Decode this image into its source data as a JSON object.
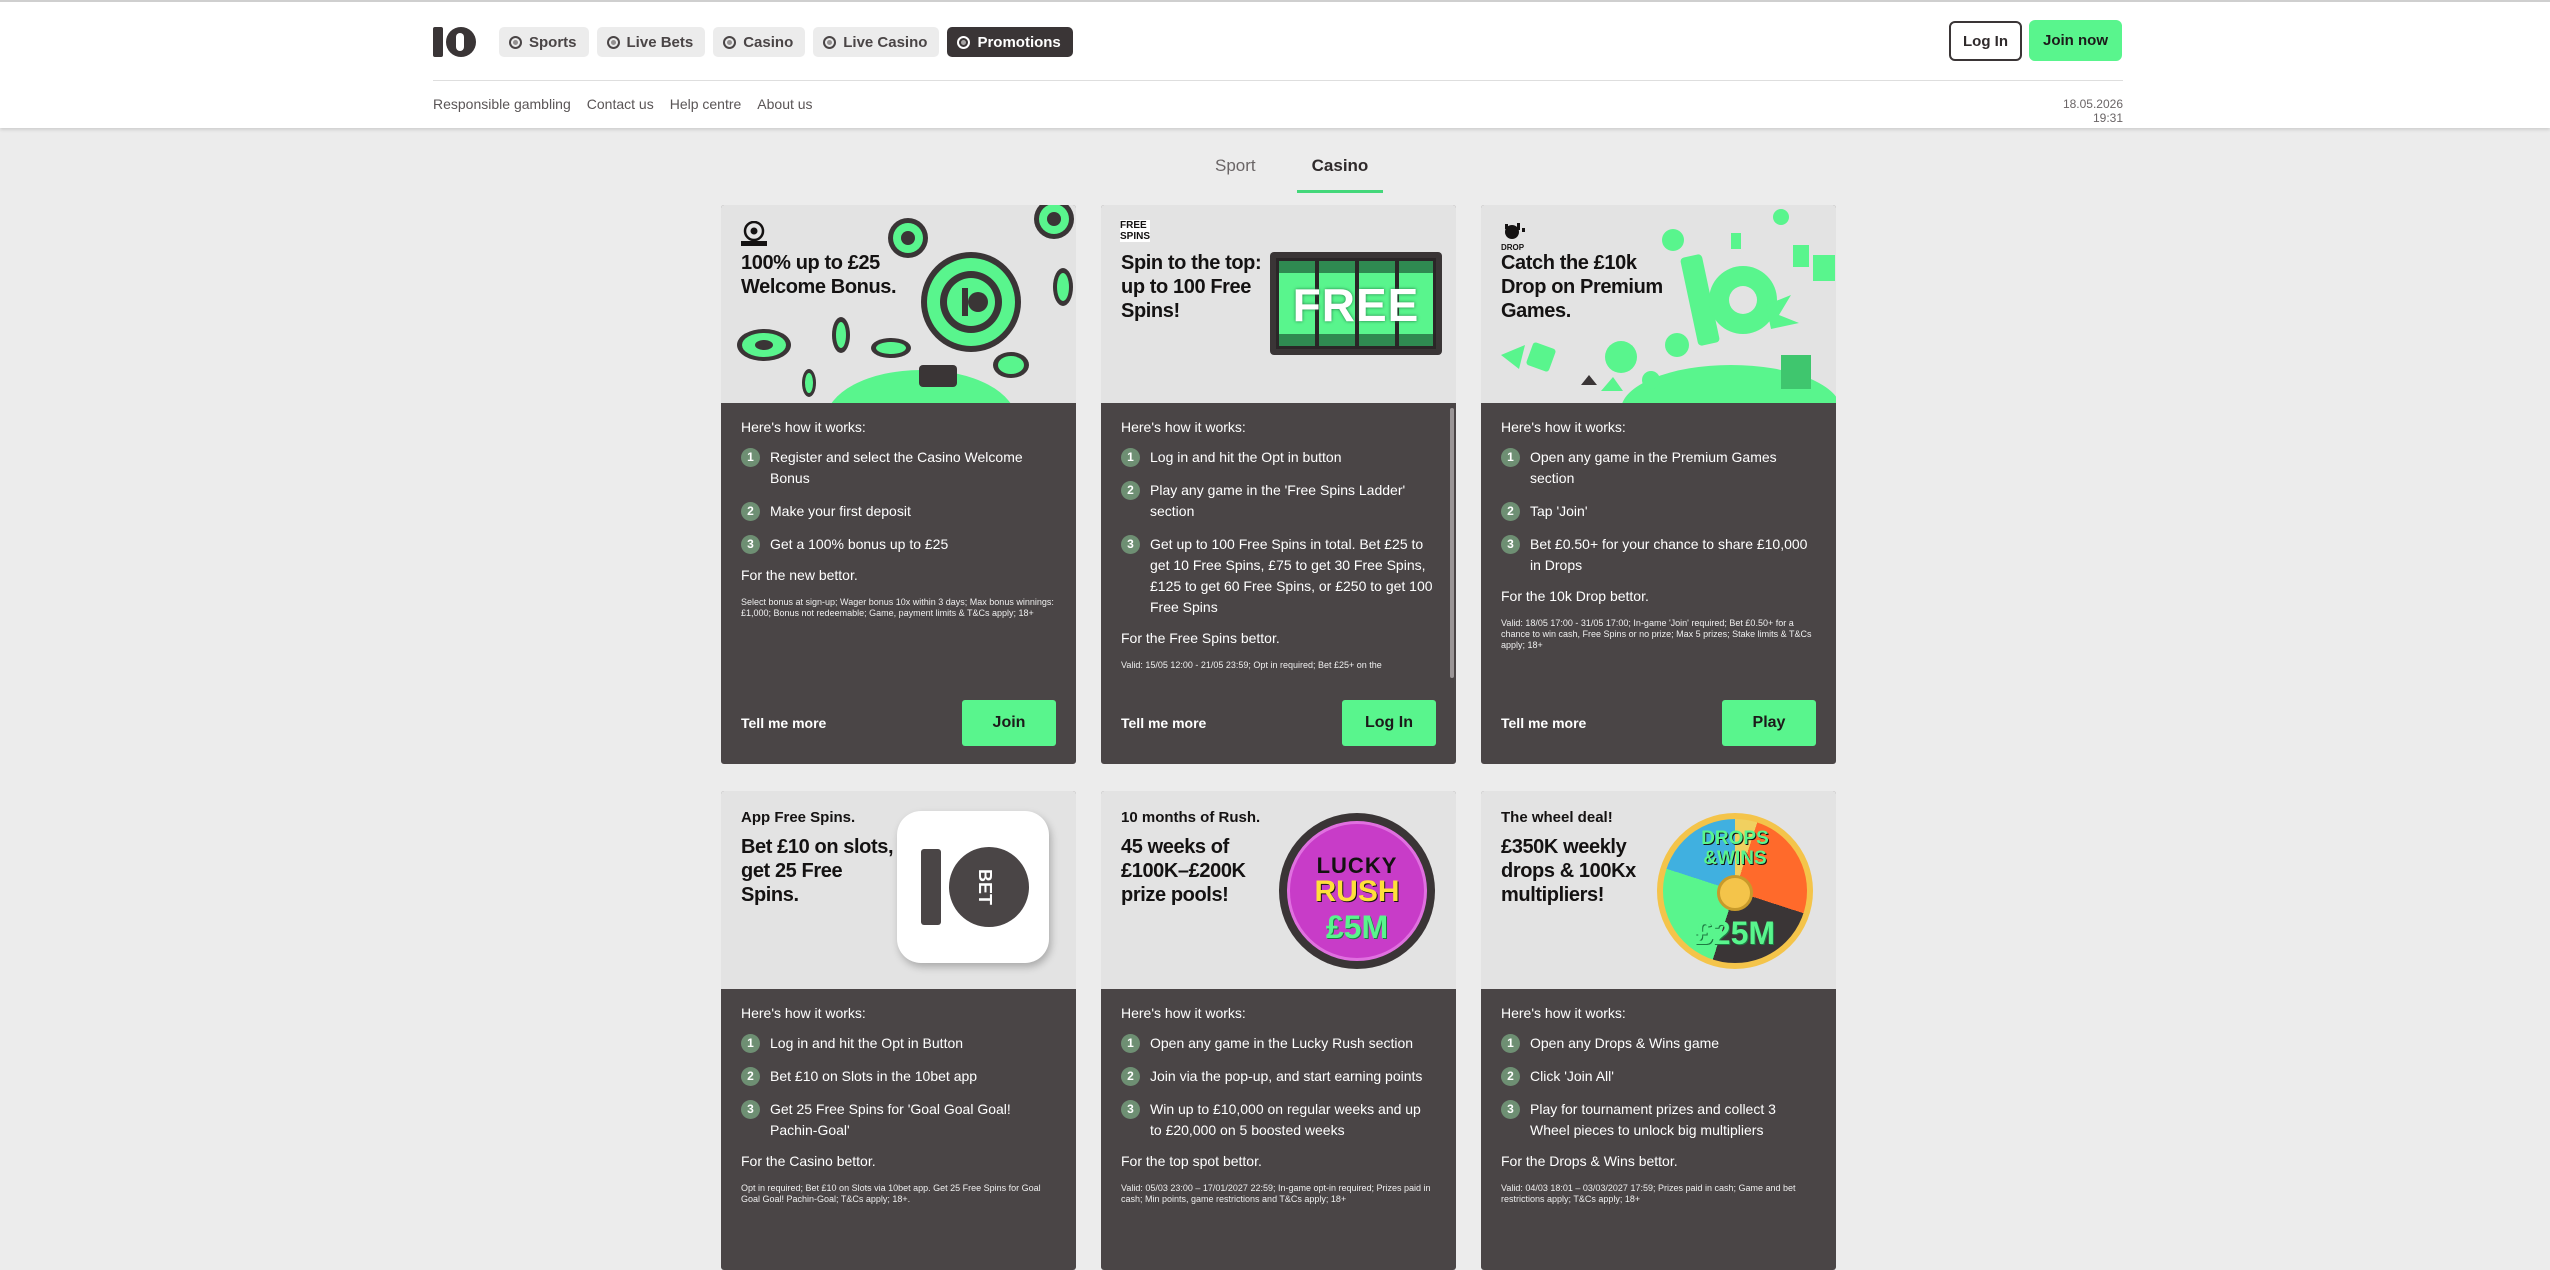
{
  "header": {
    "nav": [
      {
        "label": "Sports",
        "icon": "football-icon"
      },
      {
        "label": "Live Bets",
        "icon": "live-icon"
      },
      {
        "label": "Casino",
        "icon": "casino-chip-icon"
      },
      {
        "label": "Live Casino",
        "icon": "dealer-icon"
      },
      {
        "label": "Promotions",
        "icon": "promotion-icon"
      }
    ],
    "login_label": "Log In",
    "join_label": "Join now",
    "sublinks": [
      "Responsible gambling",
      "Contact us",
      "Help centre",
      "About us"
    ],
    "datetime": "18.05.2026 19:31"
  },
  "colors": {
    "accent": "#59f58d",
    "dark": "#4a4546",
    "nav_active": "#3a3536"
  },
  "tabs": [
    {
      "label": "Sport"
    },
    {
      "label": "Casino",
      "active": true
    }
  ],
  "how_label": "Here's how it works:",
  "tell_label": "Tell me more",
  "cards": [
    {
      "headline": "100% up to £25 Welcome Bonus.",
      "steps": [
        "Register and select the Casino Welcome Bonus",
        "Make your first deposit",
        "Get a 100% bonus up to £25"
      ],
      "for_text": "For the new bettor.",
      "terms": "Select bonus at sign-up; Wager bonus 10x within 3 days; Max bonus winnings: £1,000; Bonus not redeemable; Game, payment limits & T&Cs apply; 18+",
      "cta": "Join"
    },
    {
      "headline": "Spin to the top: up to 100 Free Spins!",
      "badge_text": "FREE SPINS",
      "reel_text": "FREE",
      "steps": [
        "Log in and hit the Opt in button",
        "Play any game in the 'Free Spins Ladder' section",
        "Get up to 100 Free Spins in total. Bet £25 to get 10 Free Spins, £75 to get 30 Free Spins, £125 to get 60 Free Spins, or £250 to get 100 Free Spins"
      ],
      "for_text": "For the Free Spins bettor.",
      "terms": "Valid: 15/05 12:00 - 21/05 23:59; Opt in required; Bet £25+ on the",
      "cta": "Log In"
    },
    {
      "headline": "Catch the £10k Drop on Premium Games.",
      "badge_text": "DROP",
      "steps": [
        "Open any game in the Premium Games section",
        "Tap 'Join'",
        "Bet £0.50+ for your chance to share £10,000 in Drops"
      ],
      "for_text": "For the 10k Drop bettor.",
      "terms": "Valid: 18/05 17:00 - 31/05 17:00; In-game 'Join' required; Bet £0.50+ for a chance to win cash, Free Spins or no prize; Max 5 prizes; Stake limits & T&Cs apply; 18+",
      "cta": "Play"
    },
    {
      "kicker": "App Free Spins.",
      "headline": "Bet £10 on slots, get 25 Free Spins.",
      "tile_text": "BET",
      "steps": [
        "Log in and hit the Opt in Button",
        "Bet £10 on Slots in the 10bet app",
        "Get 25 Free Spins for 'Goal Goal Goal! Pachin-Goal'"
      ],
      "for_text": "For the Casino bettor.",
      "terms": "Opt in required; Bet £10 on Slots via 10bet app. Get 25 Free Spins for Goal Goal Goal! Pachin-Goal; T&Cs apply; 18+."
    },
    {
      "kicker": "10 months of Rush.",
      "headline": "45 weeks of £100K–£200K prize pools!",
      "disc_lines": [
        "LUCKY",
        "RUSH",
        "£5M"
      ],
      "steps": [
        "Open any game in the Lucky Rush section",
        "Join via the pop-up, and start earning points",
        "Win up to £10,000 on regular weeks and up to £20,000 on 5 boosted weeks"
      ],
      "for_text": "For the top spot bettor.",
      "terms": "Valid: 05/03 23:00 – 17/01/2027 22:59; In-game opt-in required; Prizes paid in cash; Min points, game restrictions and T&Cs apply; 18+"
    },
    {
      "kicker": "The wheel deal!",
      "headline": "£350K weekly drops & 100Kx multipliers!",
      "wheel_lines": [
        "DROPS",
        "&WINS",
        "£25M"
      ],
      "steps": [
        "Open any Drops & Wins game",
        "Click 'Join All'",
        "Play for tournament prizes and collect 3 Wheel pieces to unlock big multipliers"
      ],
      "for_text": "For the Drops & Wins bettor.",
      "terms": "Valid: 04/03 18:01 – 03/03/2027 17:59; Prizes paid in cash; Game and bet restrictions apply; T&Cs apply; 18+"
    }
  ]
}
